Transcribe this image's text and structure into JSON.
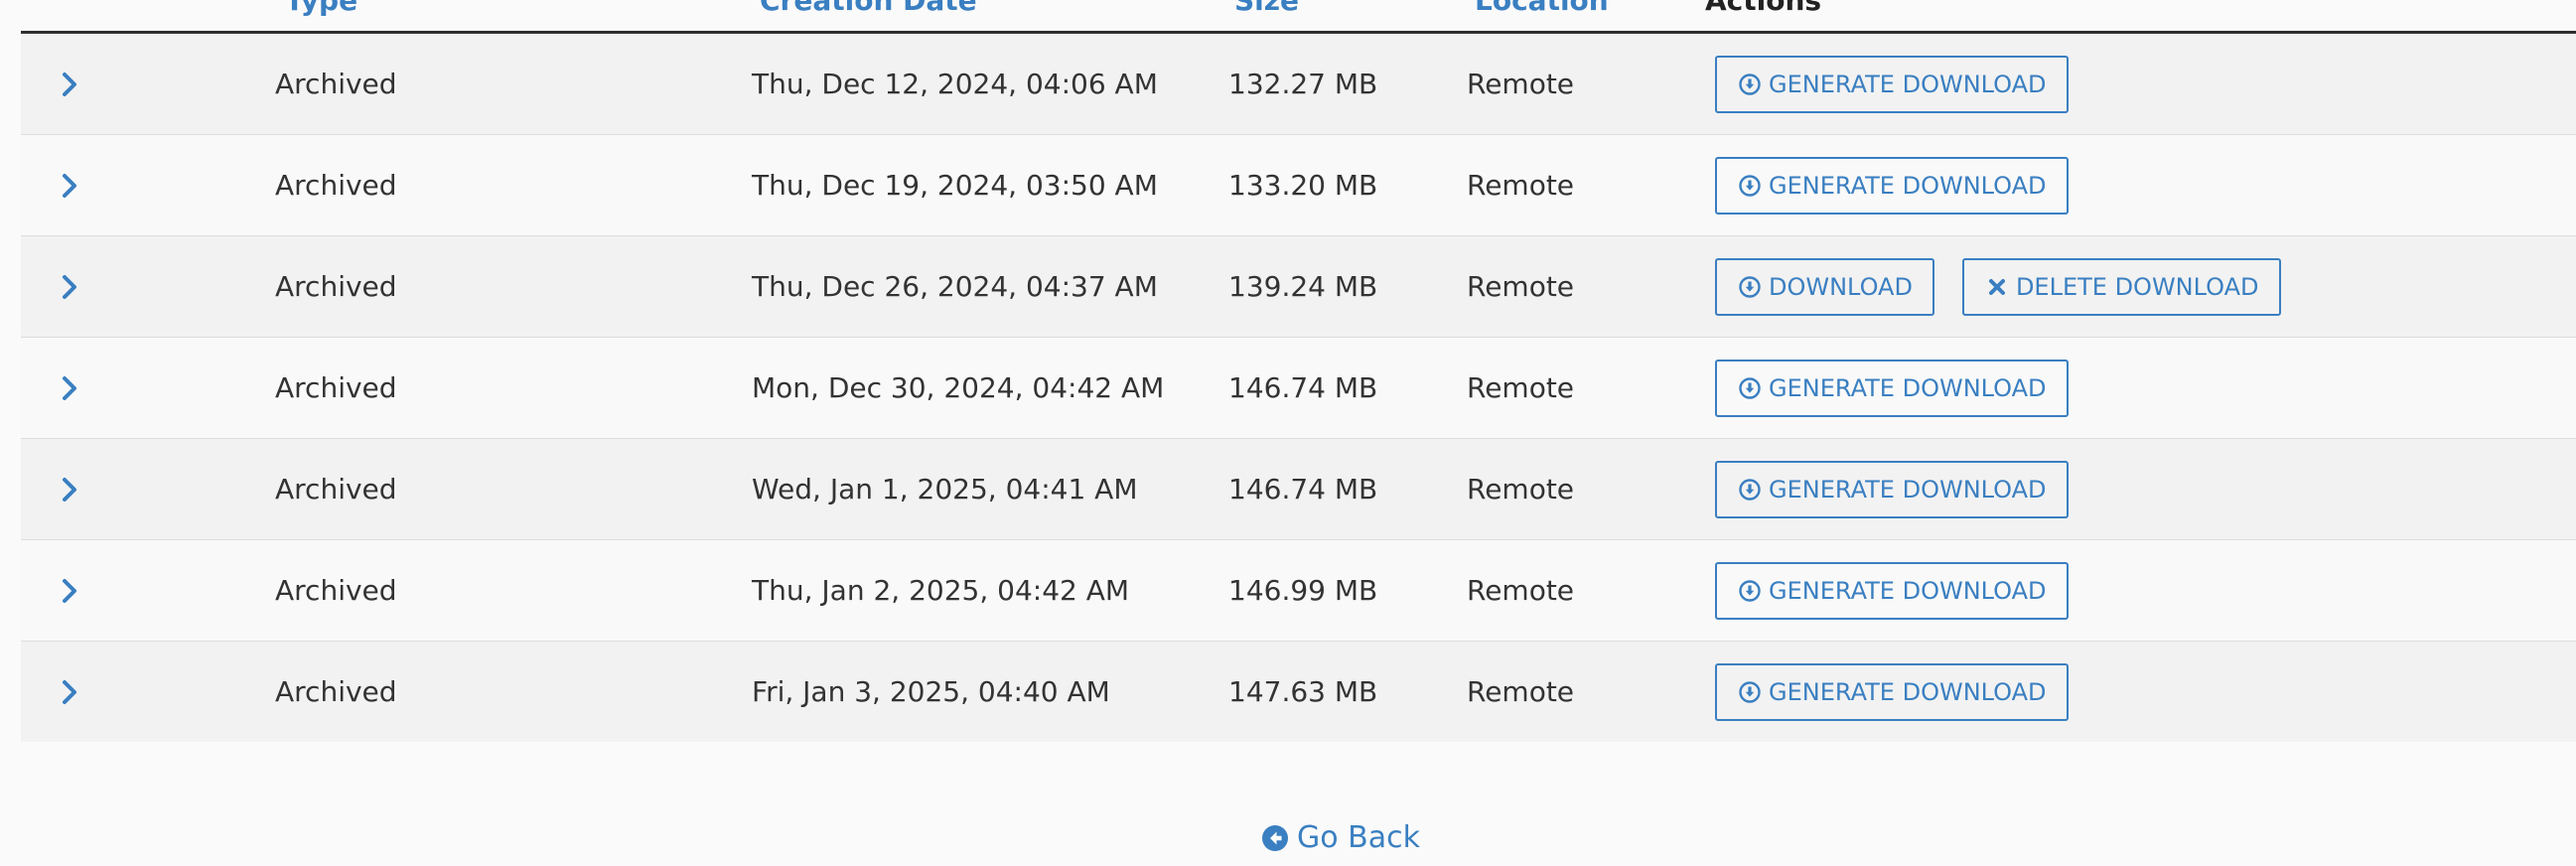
{
  "table": {
    "headers": {
      "type": "Type",
      "creation_date": "Creation Date",
      "size": "Size",
      "location": "Location",
      "actions": "Actions"
    },
    "rows": [
      {
        "type": "Archived",
        "date": "Thu, Dec 12, 2024, 04:06 AM",
        "size": "132.27 MB",
        "location": "Remote",
        "actions": [
          {
            "label": "GENERATE DOWNLOAD",
            "icon": "download-circle-icon"
          }
        ]
      },
      {
        "type": "Archived",
        "date": "Thu, Dec 19, 2024, 03:50 AM",
        "size": "133.20 MB",
        "location": "Remote",
        "actions": [
          {
            "label": "GENERATE DOWNLOAD",
            "icon": "download-circle-icon"
          }
        ]
      },
      {
        "type": "Archived",
        "date": "Thu, Dec 26, 2024, 04:37 AM",
        "size": "139.24 MB",
        "location": "Remote",
        "actions": [
          {
            "label": "DOWNLOAD",
            "icon": "download-circle-icon"
          },
          {
            "label": "DELETE DOWNLOAD",
            "icon": "close-icon"
          }
        ]
      },
      {
        "type": "Archived",
        "date": "Mon, Dec 30, 2024, 04:42 AM",
        "size": "146.74 MB",
        "location": "Remote",
        "actions": [
          {
            "label": "GENERATE DOWNLOAD",
            "icon": "download-circle-icon"
          }
        ]
      },
      {
        "type": "Archived",
        "date": "Wed, Jan 1, 2025, 04:41 AM",
        "size": "146.74 MB",
        "location": "Remote",
        "actions": [
          {
            "label": "GENERATE DOWNLOAD",
            "icon": "download-circle-icon"
          }
        ]
      },
      {
        "type": "Archived",
        "date": "Thu, Jan 2, 2025, 04:42 AM",
        "size": "146.99 MB",
        "location": "Remote",
        "actions": [
          {
            "label": "GENERATE DOWNLOAD",
            "icon": "download-circle-icon"
          }
        ]
      },
      {
        "type": "Archived",
        "date": "Fri, Jan 3, 2025, 04:40 AM",
        "size": "147.63 MB",
        "location": "Remote",
        "actions": [
          {
            "label": "GENERATE DOWNLOAD",
            "icon": "download-circle-icon"
          }
        ]
      }
    ]
  },
  "footer": {
    "go_back_label": "Go Back",
    "go_back_icon": "arrow-circle-left-icon"
  },
  "colors": {
    "accent": "#3a7fc1",
    "row_odd": "#f2f2f2",
    "row_even": "#f9f9f9",
    "text": "#333333"
  }
}
